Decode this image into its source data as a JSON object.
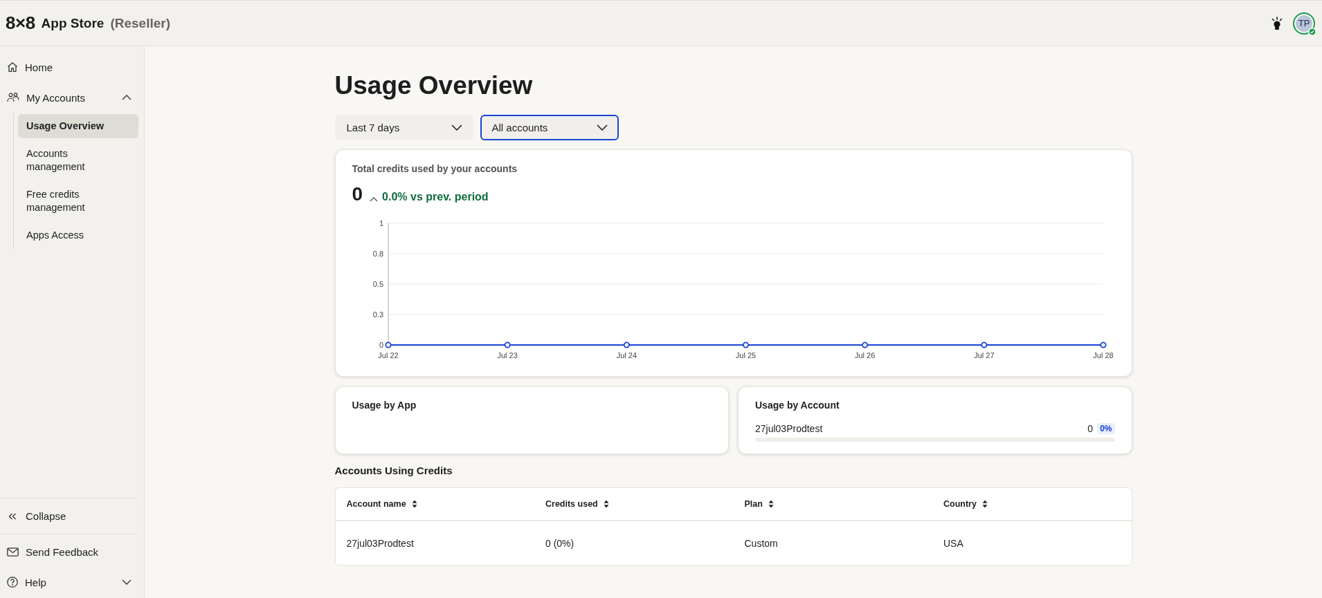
{
  "header": {
    "logo": "8×8",
    "title": "App Store",
    "subtitle": "(Reseller)",
    "avatar": {
      "initials": "TP",
      "online": true
    }
  },
  "sidebar": {
    "nav": [
      {
        "kind": "link",
        "label": "Home",
        "selected": false
      },
      {
        "kind": "group",
        "label": "My Accounts",
        "selected": false,
        "expanded": true,
        "children": [
          {
            "label": "Usage Overview",
            "selected": true
          },
          {
            "label": "Accounts management",
            "selected": false
          },
          {
            "label": "Free credits management",
            "selected": false
          },
          {
            "label": "Apps Access",
            "selected": false
          }
        ]
      }
    ],
    "collapse": "Collapse",
    "footer": [
      {
        "kind": "link",
        "label": "Send Feedback"
      },
      {
        "kind": "group",
        "label": "Help",
        "expanded": false
      }
    ]
  },
  "page_title": "Usage Overview",
  "filters": [
    {
      "value": "Last 7 days",
      "focused": false
    },
    {
      "value": "All accounts",
      "focused": true
    }
  ],
  "credits": {
    "title": "Total credits used by your accounts",
    "total": "0",
    "increase": true,
    "change": "0.0% vs prev. period",
    "chart_data": {
      "type": "line",
      "grid": true,
      "categories": [
        "Jul 22",
        "Jul 23",
        "Jul 24",
        "Jul 25",
        "Jul 26",
        "Jul 27",
        "Jul 28"
      ],
      "series": [
        {
          "color": "#1743d6",
          "marker": "circle",
          "values": [
            0,
            0,
            0,
            0,
            0,
            0,
            0
          ]
        }
      ],
      "ylim": [
        0,
        1
      ],
      "yticks": [
        0,
        {
          "value": 0.25,
          "label": "0.3"
        },
        0.5,
        {
          "value": 0.75,
          "label": "0.8"
        },
        1
      ]
    }
  },
  "usage_by_app": {
    "title": "Usage by App"
  },
  "usage_by_account": {
    "title": "Usage by Account",
    "rows": [
      {
        "name": "27jul03Prodtest",
        "credits": "0",
        "share": "0%",
        "level": 0
      }
    ]
  },
  "accounts_table": {
    "title": "Accounts Using Credits",
    "columns": [
      "Account name",
      "Credits used",
      "Plan",
      "Country"
    ],
    "rows": [
      [
        "27jul03Prodtest",
        "0 (0%)",
        "Custom",
        "USA"
      ]
    ]
  }
}
